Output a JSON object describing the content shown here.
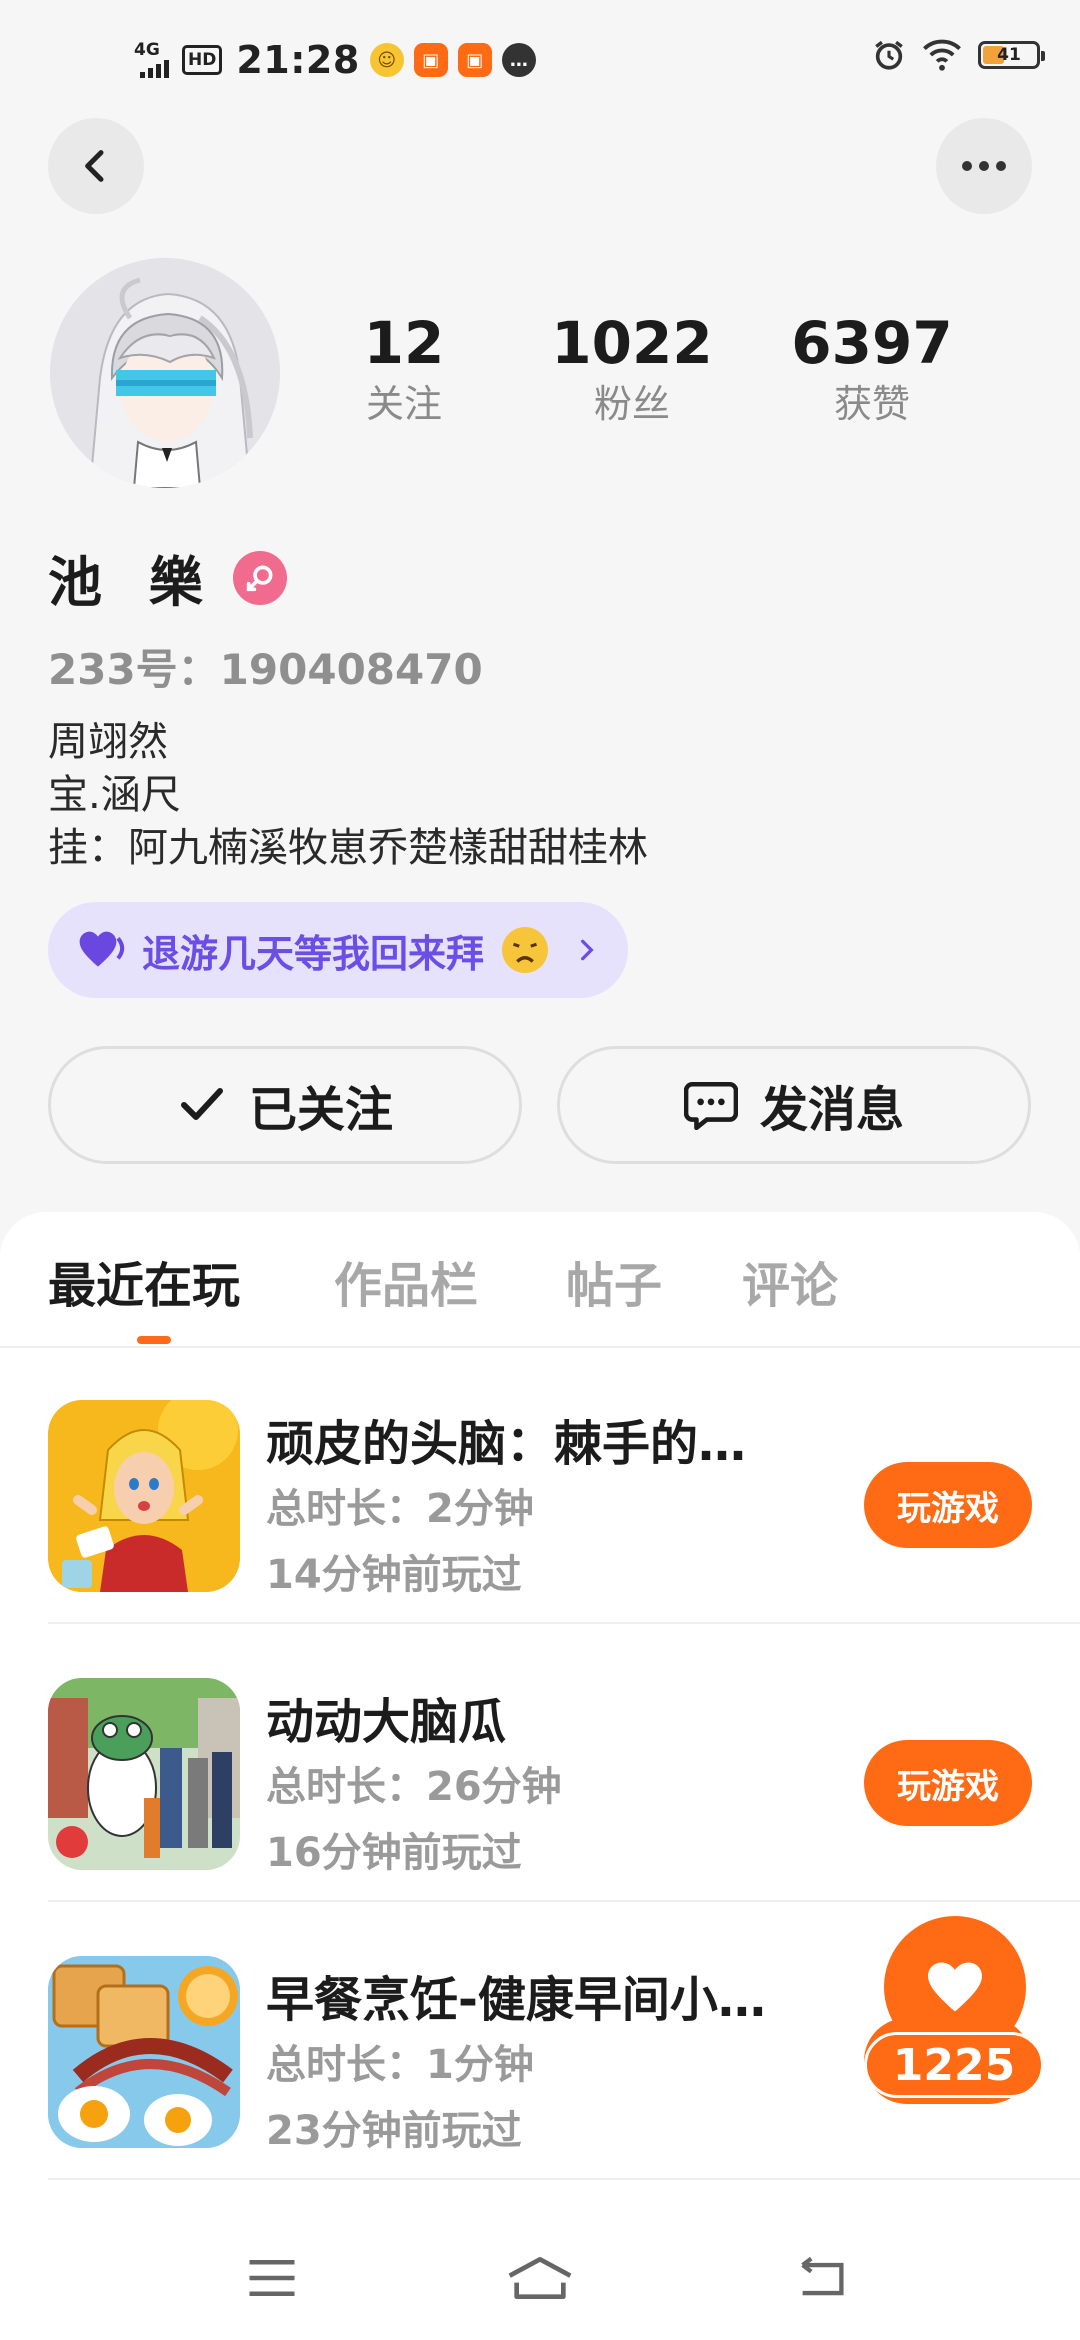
{
  "status_bar": {
    "network": "4G",
    "hd": "HD",
    "time": "21:28",
    "battery": "41",
    "battery_level": 0.41
  },
  "header": {
    "back_icon": "chevron-left-icon",
    "more_icon": "more-dots-icon"
  },
  "profile": {
    "name": "池 樂",
    "gender": "female",
    "id_line": "233号：190408470",
    "bio": [
      "周翊然",
      "宝.涵尺",
      "挂：阿九楠溪牧崽乔楚樣甜甜桂林"
    ],
    "signature": "退游几天等我回来拜",
    "stats": [
      {
        "value": "12",
        "label": "关注"
      },
      {
        "value": "1022",
        "label": "粉丝"
      },
      {
        "value": "6397",
        "label": "获赞"
      }
    ]
  },
  "actions": {
    "follow_label": "已关注",
    "message_label": "发消息"
  },
  "tabs": [
    "最近在玩",
    "作品栏",
    "帖子",
    "评论"
  ],
  "games": [
    {
      "title": "顽皮的头脑：棘手的…",
      "duration": "总时长：2分钟",
      "last_played": "14分钟前玩过",
      "button": "玩游戏"
    },
    {
      "title": "动动大脑瓜",
      "duration": "总时长：26分钟",
      "last_played": "16分钟前玩过",
      "button": "玩游戏"
    },
    {
      "title": "早餐烹饪-健康早间小…",
      "duration": "总时长：1分钟",
      "last_played": "23分钟前玩过",
      "button": "玩游戏"
    }
  ],
  "like_float": {
    "count": "1225"
  },
  "colors": {
    "accent": "#ff6a14",
    "signature_bg": "#e6e2fb",
    "signature_text": "#6b4ee6",
    "gender_badge": "#f06b8d"
  }
}
